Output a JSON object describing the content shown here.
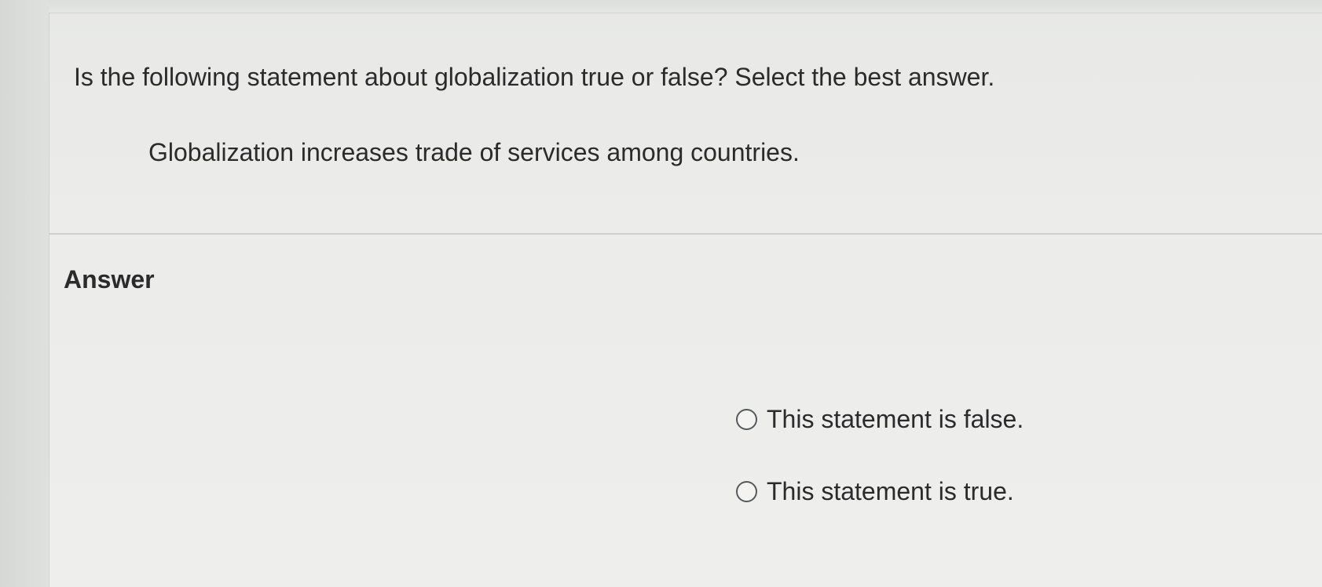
{
  "question": {
    "prompt": "Is the following statement about globalization true or false? Select the best answer.",
    "statement": "Globalization increases trade of services among countries."
  },
  "answer": {
    "heading": "Answer",
    "options": [
      {
        "label": "This statement is false.",
        "selected": false
      },
      {
        "label": "This statement is true.",
        "selected": false
      }
    ]
  }
}
